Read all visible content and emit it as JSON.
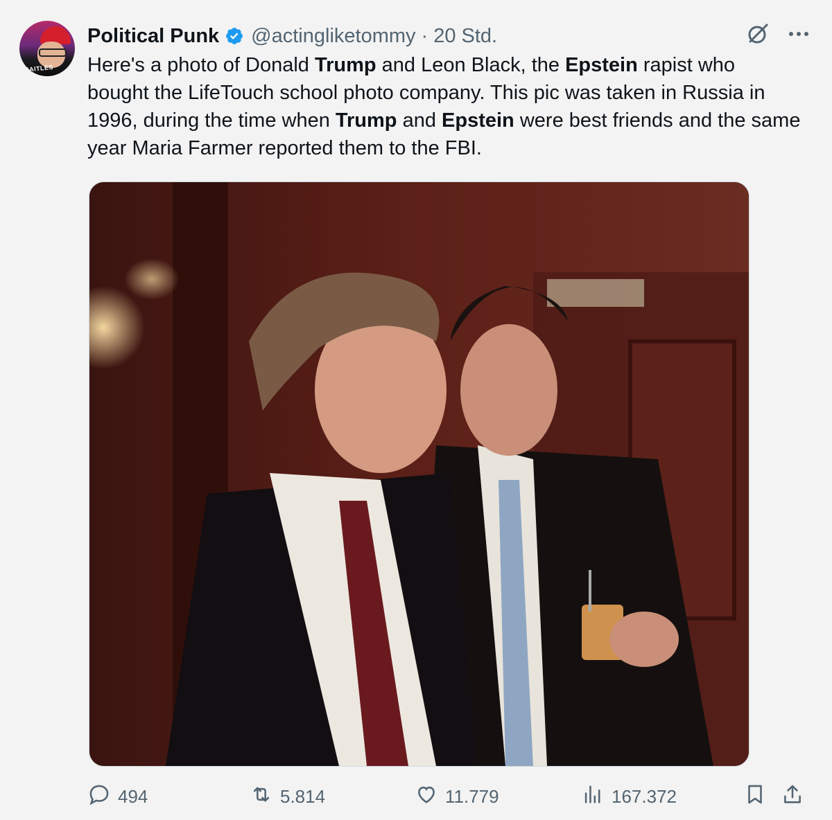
{
  "tweet": {
    "author_name": "Political Punk",
    "handle": "@actingliketommy",
    "separator": "·",
    "time": "20 Std.",
    "text": {
      "p1": "Here's a photo of Donald ",
      "b1": "Trump",
      "p2": " and Leon Black, the ",
      "b2": "Epstein",
      "p3": " rapist who bought the LifeTouch school photo company. This pic was taken in Russia in 1996, during the time when ",
      "b3": "Trump",
      "p4": " and ",
      "b4": "Epstein",
      "p5": " were best friends and the same year Maria Farmer reported them to the FBI."
    },
    "avatar_text": "MAITLES"
  },
  "actions": {
    "replies": "494",
    "reposts": "5.814",
    "likes": "11.779",
    "views": "167.372"
  },
  "icons": {
    "avatar": "avatar-image",
    "verified": "verified-badge-icon",
    "grok": "grok-icon",
    "more": "more-icon",
    "reply": "reply-icon",
    "repost": "repost-icon",
    "like": "like-icon",
    "views": "views-icon",
    "bookmark": "bookmark-icon",
    "share": "share-icon"
  },
  "colors": {
    "accent": "#1d9bf0",
    "muted": "#536471",
    "text": "#0f1419"
  }
}
